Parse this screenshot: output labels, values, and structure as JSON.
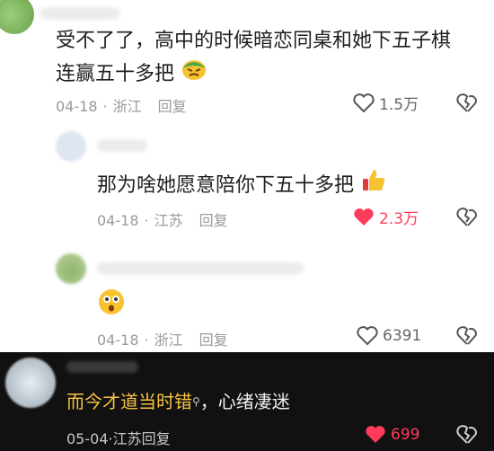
{
  "comments": [
    {
      "text_line1": "受不了了，高中的时候暗恋同桌和她下五子棋",
      "text_line2": "连赢五十多把",
      "date": "04-18",
      "location": "浙江",
      "reply_label": "回复",
      "likes": "1.5万",
      "liked": false,
      "emoji_icon": "green-annoyed-face-icon"
    },
    {
      "text": "那为啥她愿意陪你下五十多把",
      "date": "04-18",
      "location": "江苏",
      "reply_label": "回复",
      "likes": "2.3万",
      "liked": true,
      "emoji_icon": "thumbs-up-icon"
    },
    {
      "text": "",
      "date": "04-18",
      "location": "浙江",
      "reply_label": "回复",
      "likes": "6391",
      "liked": false,
      "emoji_icon": "surprised-face-icon"
    },
    {
      "text_main": "而今才道当时错",
      "text_rest": "，心绪凄迷",
      "date": "05-04",
      "location": "江苏",
      "reply_label": "回复",
      "likes": "699",
      "liked": true,
      "search_icon": "search-icon"
    }
  ],
  "colors": {
    "liked_heart": "#ff3b5c",
    "highlight_text": "#f6c343",
    "dark_bar": "#111111"
  }
}
